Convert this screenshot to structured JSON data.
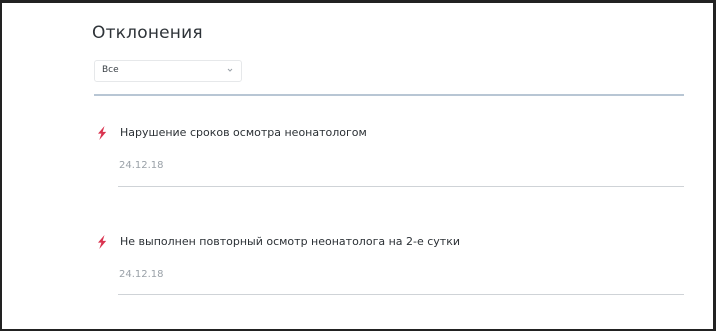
{
  "panel": {
    "title": "Отклонения",
    "filter": {
      "selected": "Все"
    },
    "accent_color": "#d9334f"
  },
  "deviations": [
    {
      "title": "Нарушение сроков осмотра неонатологом",
      "date": "24.12.18",
      "icon": "lightning-icon"
    },
    {
      "title": "Не выполнен повторный осмотр неонатолога на 2-е сутки",
      "date": "24.12.18",
      "icon": "lightning-icon"
    }
  ]
}
